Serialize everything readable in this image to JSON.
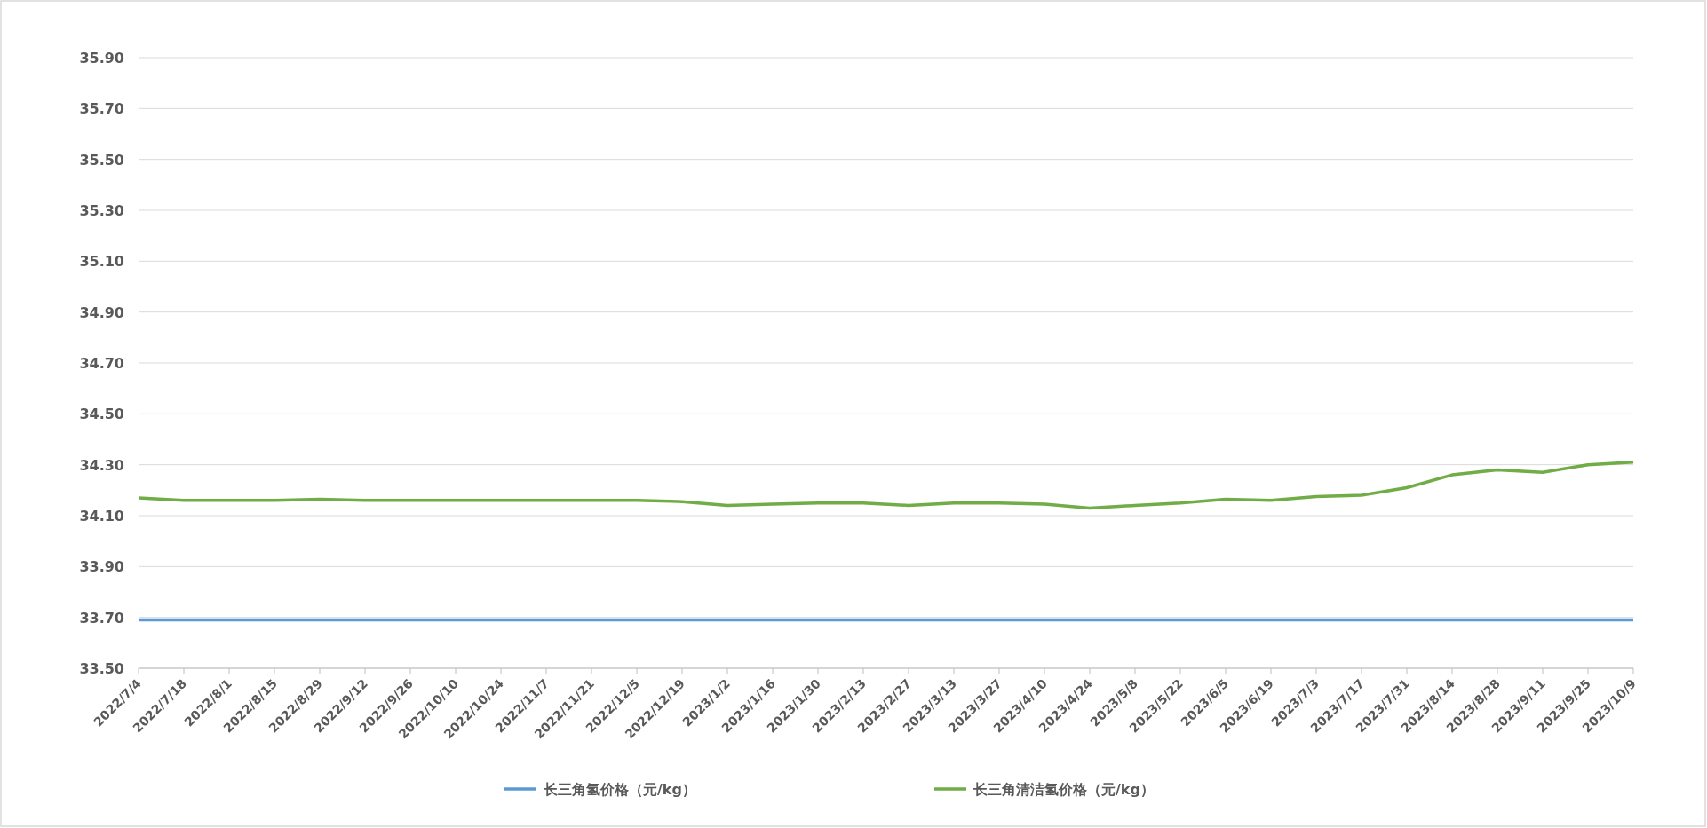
{
  "chart_data": {
    "type": "line",
    "categories": [
      "2022/7/4",
      "2022/7/18",
      "2022/8/1",
      "2022/8/15",
      "2022/8/29",
      "2022/9/12",
      "2022/9/26",
      "2022/10/10",
      "2022/10/24",
      "2022/11/7",
      "2022/11/21",
      "2022/12/5",
      "2022/12/19",
      "2023/1/2",
      "2023/1/16",
      "2023/1/30",
      "2023/2/13",
      "2023/2/27",
      "2023/3/13",
      "2023/3/27",
      "2023/4/10",
      "2023/4/24",
      "2023/5/8",
      "2023/5/22",
      "2023/6/5",
      "2023/6/19",
      "2023/7/3",
      "2023/7/17",
      "2023/7/31",
      "2023/8/14",
      "2023/8/28",
      "2023/9/11",
      "2023/9/25",
      "2023/10/9"
    ],
    "series": [
      {
        "name": "长三角氢价格（元/kg）",
        "color": "#5b9bd5",
        "values": [
          33.69,
          33.69,
          33.69,
          33.69,
          33.69,
          33.69,
          33.69,
          33.69,
          33.69,
          33.69,
          33.69,
          33.69,
          33.69,
          33.69,
          33.69,
          33.69,
          33.69,
          33.69,
          33.69,
          33.69,
          33.69,
          33.69,
          33.69,
          33.69,
          33.69,
          33.69,
          33.69,
          33.69,
          33.69,
          33.69,
          33.69,
          33.69,
          33.69,
          33.69
        ]
      },
      {
        "name": "长三角清洁氢价格（元/kg）",
        "color": "#70ad47",
        "values": [
          34.17,
          34.16,
          34.16,
          34.16,
          34.165,
          34.16,
          34.16,
          34.16,
          34.16,
          34.16,
          34.16,
          34.16,
          34.155,
          34.14,
          34.145,
          34.15,
          34.15,
          34.14,
          34.15,
          34.15,
          34.145,
          34.13,
          34.14,
          34.15,
          34.165,
          34.16,
          34.175,
          34.18,
          34.21,
          34.26,
          34.28,
          34.27,
          34.3,
          34.31
        ]
      }
    ],
    "ylim": [
      33.5,
      35.9
    ],
    "grid": true,
    "legend": true,
    "yticks": [
      {
        "value": 33.5,
        "label": "33.50"
      },
      {
        "value": 33.7,
        "label": "33.70"
      },
      {
        "value": 33.9,
        "label": "33.90"
      },
      {
        "value": 34.1,
        "label": "34.10"
      },
      {
        "value": 34.3,
        "label": "34.30"
      },
      {
        "value": 34.5,
        "label": "34.50"
      },
      {
        "value": 34.7,
        "label": "34.70"
      },
      {
        "value": 34.9,
        "label": "34.90"
      },
      {
        "value": 35.1,
        "label": "35.10"
      },
      {
        "value": 35.3,
        "label": "35.30"
      },
      {
        "value": 35.5,
        "label": "35.50"
      },
      {
        "value": 35.7,
        "label": "35.70"
      },
      {
        "value": 35.9,
        "label": "35.90"
      }
    ]
  }
}
